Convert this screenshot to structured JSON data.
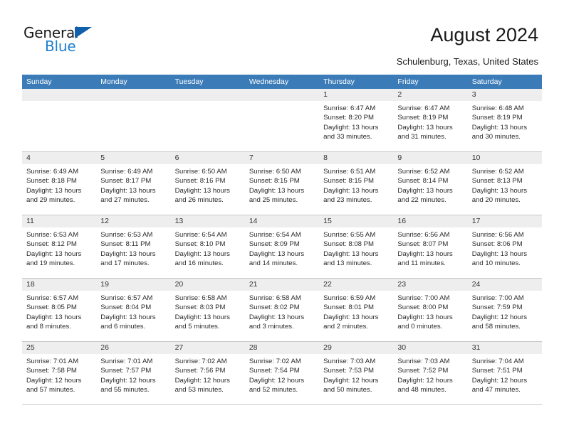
{
  "brand": {
    "name_part1": "General",
    "name_part2": "Blue",
    "triangle_color": "#1060ab",
    "blue_color": "#1d7fd0"
  },
  "header": {
    "title": "August 2024",
    "subtitle": "Schulenburg, Texas, United States"
  },
  "theme": {
    "header_blue": "#3b7cb8",
    "daynum_band": "#eeeeee",
    "grid_line": "#c8c8c8"
  },
  "calendar": {
    "weekdays": [
      "Sunday",
      "Monday",
      "Tuesday",
      "Wednesday",
      "Thursday",
      "Friday",
      "Saturday"
    ],
    "weeks": [
      [
        {
          "day": "",
          "lines": []
        },
        {
          "day": "",
          "lines": []
        },
        {
          "day": "",
          "lines": []
        },
        {
          "day": "",
          "lines": []
        },
        {
          "day": "1",
          "lines": [
            "Sunrise: 6:47 AM",
            "Sunset: 8:20 PM",
            "Daylight: 13 hours",
            "and 33 minutes."
          ]
        },
        {
          "day": "2",
          "lines": [
            "Sunrise: 6:47 AM",
            "Sunset: 8:19 PM",
            "Daylight: 13 hours",
            "and 31 minutes."
          ]
        },
        {
          "day": "3",
          "lines": [
            "Sunrise: 6:48 AM",
            "Sunset: 8:19 PM",
            "Daylight: 13 hours",
            "and 30 minutes."
          ]
        }
      ],
      [
        {
          "day": "4",
          "lines": [
            "Sunrise: 6:49 AM",
            "Sunset: 8:18 PM",
            "Daylight: 13 hours",
            "and 29 minutes."
          ]
        },
        {
          "day": "5",
          "lines": [
            "Sunrise: 6:49 AM",
            "Sunset: 8:17 PM",
            "Daylight: 13 hours",
            "and 27 minutes."
          ]
        },
        {
          "day": "6",
          "lines": [
            "Sunrise: 6:50 AM",
            "Sunset: 8:16 PM",
            "Daylight: 13 hours",
            "and 26 minutes."
          ]
        },
        {
          "day": "7",
          "lines": [
            "Sunrise: 6:50 AM",
            "Sunset: 8:15 PM",
            "Daylight: 13 hours",
            "and 25 minutes."
          ]
        },
        {
          "day": "8",
          "lines": [
            "Sunrise: 6:51 AM",
            "Sunset: 8:15 PM",
            "Daylight: 13 hours",
            "and 23 minutes."
          ]
        },
        {
          "day": "9",
          "lines": [
            "Sunrise: 6:52 AM",
            "Sunset: 8:14 PM",
            "Daylight: 13 hours",
            "and 22 minutes."
          ]
        },
        {
          "day": "10",
          "lines": [
            "Sunrise: 6:52 AM",
            "Sunset: 8:13 PM",
            "Daylight: 13 hours",
            "and 20 minutes."
          ]
        }
      ],
      [
        {
          "day": "11",
          "lines": [
            "Sunrise: 6:53 AM",
            "Sunset: 8:12 PM",
            "Daylight: 13 hours",
            "and 19 minutes."
          ]
        },
        {
          "day": "12",
          "lines": [
            "Sunrise: 6:53 AM",
            "Sunset: 8:11 PM",
            "Daylight: 13 hours",
            "and 17 minutes."
          ]
        },
        {
          "day": "13",
          "lines": [
            "Sunrise: 6:54 AM",
            "Sunset: 8:10 PM",
            "Daylight: 13 hours",
            "and 16 minutes."
          ]
        },
        {
          "day": "14",
          "lines": [
            "Sunrise: 6:54 AM",
            "Sunset: 8:09 PM",
            "Daylight: 13 hours",
            "and 14 minutes."
          ]
        },
        {
          "day": "15",
          "lines": [
            "Sunrise: 6:55 AM",
            "Sunset: 8:08 PM",
            "Daylight: 13 hours",
            "and 13 minutes."
          ]
        },
        {
          "day": "16",
          "lines": [
            "Sunrise: 6:56 AM",
            "Sunset: 8:07 PM",
            "Daylight: 13 hours",
            "and 11 minutes."
          ]
        },
        {
          "day": "17",
          "lines": [
            "Sunrise: 6:56 AM",
            "Sunset: 8:06 PM",
            "Daylight: 13 hours",
            "and 10 minutes."
          ]
        }
      ],
      [
        {
          "day": "18",
          "lines": [
            "Sunrise: 6:57 AM",
            "Sunset: 8:05 PM",
            "Daylight: 13 hours",
            "and 8 minutes."
          ]
        },
        {
          "day": "19",
          "lines": [
            "Sunrise: 6:57 AM",
            "Sunset: 8:04 PM",
            "Daylight: 13 hours",
            "and 6 minutes."
          ]
        },
        {
          "day": "20",
          "lines": [
            "Sunrise: 6:58 AM",
            "Sunset: 8:03 PM",
            "Daylight: 13 hours",
            "and 5 minutes."
          ]
        },
        {
          "day": "21",
          "lines": [
            "Sunrise: 6:58 AM",
            "Sunset: 8:02 PM",
            "Daylight: 13 hours",
            "and 3 minutes."
          ]
        },
        {
          "day": "22",
          "lines": [
            "Sunrise: 6:59 AM",
            "Sunset: 8:01 PM",
            "Daylight: 13 hours",
            "and 2 minutes."
          ]
        },
        {
          "day": "23",
          "lines": [
            "Sunrise: 7:00 AM",
            "Sunset: 8:00 PM",
            "Daylight: 13 hours",
            "and 0 minutes."
          ]
        },
        {
          "day": "24",
          "lines": [
            "Sunrise: 7:00 AM",
            "Sunset: 7:59 PM",
            "Daylight: 12 hours",
            "and 58 minutes."
          ]
        }
      ],
      [
        {
          "day": "25",
          "lines": [
            "Sunrise: 7:01 AM",
            "Sunset: 7:58 PM",
            "Daylight: 12 hours",
            "and 57 minutes."
          ]
        },
        {
          "day": "26",
          "lines": [
            "Sunrise: 7:01 AM",
            "Sunset: 7:57 PM",
            "Daylight: 12 hours",
            "and 55 minutes."
          ]
        },
        {
          "day": "27",
          "lines": [
            "Sunrise: 7:02 AM",
            "Sunset: 7:56 PM",
            "Daylight: 12 hours",
            "and 53 minutes."
          ]
        },
        {
          "day": "28",
          "lines": [
            "Sunrise: 7:02 AM",
            "Sunset: 7:54 PM",
            "Daylight: 12 hours",
            "and 52 minutes."
          ]
        },
        {
          "day": "29",
          "lines": [
            "Sunrise: 7:03 AM",
            "Sunset: 7:53 PM",
            "Daylight: 12 hours",
            "and 50 minutes."
          ]
        },
        {
          "day": "30",
          "lines": [
            "Sunrise: 7:03 AM",
            "Sunset: 7:52 PM",
            "Daylight: 12 hours",
            "and 48 minutes."
          ]
        },
        {
          "day": "31",
          "lines": [
            "Sunrise: 7:04 AM",
            "Sunset: 7:51 PM",
            "Daylight: 12 hours",
            "and 47 minutes."
          ]
        }
      ]
    ]
  }
}
